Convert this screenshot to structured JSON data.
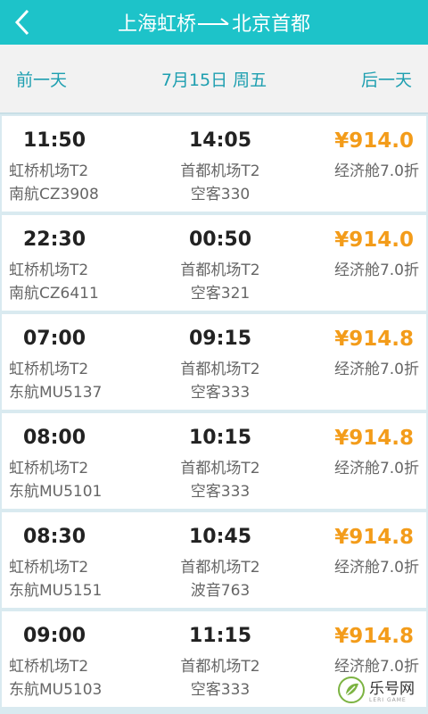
{
  "header": {
    "back_icon": "chevron-left-icon",
    "origin": "上海虹桥",
    "destination": "北京首都",
    "arrow_icon": "route-arrow-icon"
  },
  "datebar": {
    "prev_label": "前一天",
    "date_label": "7月15日 周五",
    "next_label": "后一天"
  },
  "flights": [
    {
      "depart_time": "11:50",
      "arrive_time": "14:05",
      "depart_airport": "虹桥机场T2",
      "arrive_airport": "首都机场T2",
      "flight_no": "南航CZ3908",
      "aircraft": "空客330",
      "price": "¥914.0",
      "cabin": "经济舱7.0折"
    },
    {
      "depart_time": "22:30",
      "arrive_time": "00:50",
      "depart_airport": "虹桥机场T2",
      "arrive_airport": "首都机场T2",
      "flight_no": "南航CZ6411",
      "aircraft": "空客321",
      "price": "¥914.0",
      "cabin": "经济舱7.0折"
    },
    {
      "depart_time": "07:00",
      "arrive_time": "09:15",
      "depart_airport": "虹桥机场T2",
      "arrive_airport": "首都机场T2",
      "flight_no": "东航MU5137",
      "aircraft": "空客333",
      "price": "¥914.8",
      "cabin": "经济舱7.0折"
    },
    {
      "depart_time": "08:00",
      "arrive_time": "10:15",
      "depart_airport": "虹桥机场T2",
      "arrive_airport": "首都机场T2",
      "flight_no": "东航MU5101",
      "aircraft": "空客333",
      "price": "¥914.8",
      "cabin": "经济舱7.0折"
    },
    {
      "depart_time": "08:30",
      "arrive_time": "10:45",
      "depart_airport": "虹桥机场T2",
      "arrive_airport": "首都机场T2",
      "flight_no": "东航MU5151",
      "aircraft": "波音763",
      "price": "¥914.8",
      "cabin": "经济舱7.0折"
    },
    {
      "depart_time": "09:00",
      "arrive_time": "11:15",
      "depart_airport": "虹桥机场T2",
      "arrive_airport": "首都机场T2",
      "flight_no": "东航MU5103",
      "aircraft": "空客333",
      "price": "¥914.8",
      "cabin": "经济舱7.0折"
    }
  ],
  "watermark": {
    "logo_icon": "leaf-logo-icon",
    "text": "乐号网",
    "subtext": "LERI GAME"
  },
  "colors": {
    "header_bg": "#1dc3c9",
    "date_text": "#1e9fb0",
    "price": "#f39c1a"
  }
}
